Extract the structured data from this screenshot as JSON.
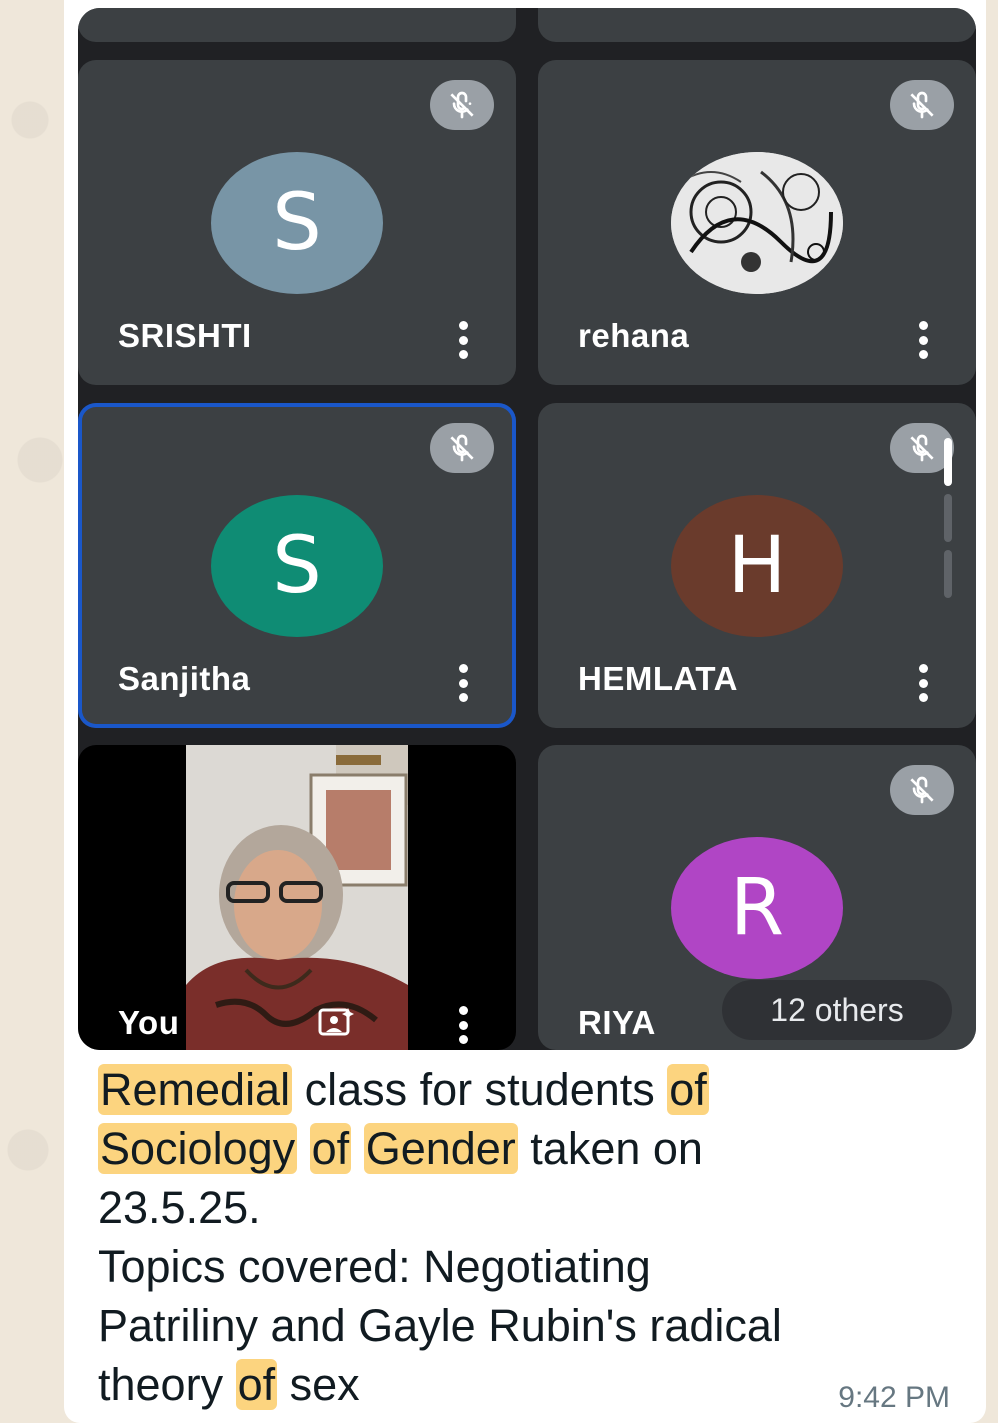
{
  "participants": [
    {
      "name": "SRISHTI",
      "initial": "S",
      "avatar_color": "#7895a6",
      "muted": true
    },
    {
      "name": "rehana",
      "initial": "",
      "avatar_color": "#d9d9d9",
      "muted": true
    },
    {
      "name": "Sanjitha",
      "initial": "S",
      "avatar_color": "#0f8c74",
      "muted": true,
      "active_speaker": true
    },
    {
      "name": "HEMLATA",
      "initial": "H",
      "avatar_color": "#6a3b2c",
      "muted": true
    },
    {
      "name": "You",
      "video_on": true
    },
    {
      "name": "RIYA",
      "initial": "R",
      "avatar_color": "#b045c5",
      "muted": true
    }
  ],
  "others_label": "12 others",
  "caption": {
    "line1": [
      "Remedial",
      " class for students ",
      "of"
    ],
    "line2": [
      "Sociology",
      " ",
      "of",
      " ",
      "Gender",
      " taken on"
    ],
    "line3": "23.5.25.",
    "line4": "Topics covered: Negotiating",
    "line5": "Patriliny and Gayle Rubin's radical",
    "line6": [
      "theory ",
      "of",
      " sex"
    ]
  },
  "timestamp": "9:42 PM",
  "colors": {
    "tile_bg": "#3c4043",
    "frame_bg": "#202124",
    "highlight": "#fcd47f",
    "active_border": "#1a57c9"
  }
}
